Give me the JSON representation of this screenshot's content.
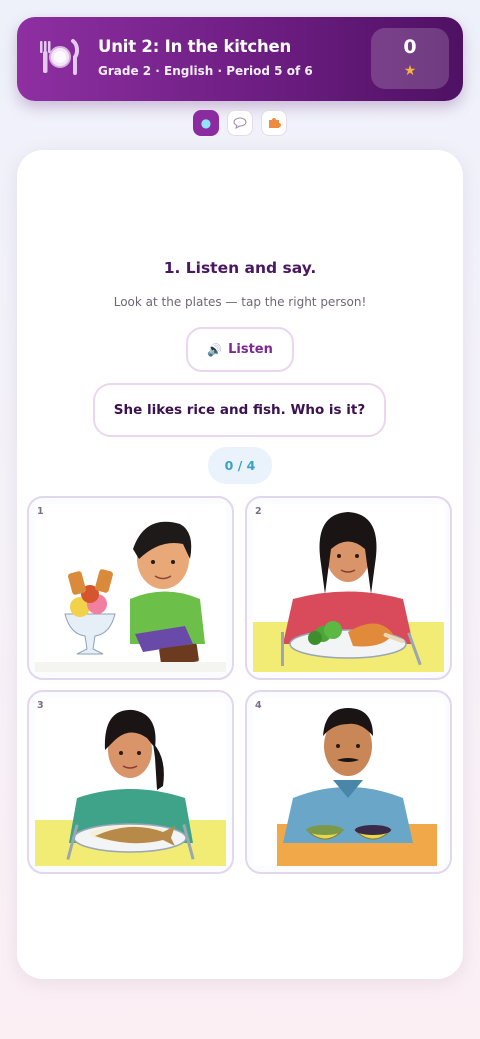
{
  "header": {
    "title": "Unit 2: In the kitchen",
    "subtitle": "Grade 2 · English · Period 5 of 6",
    "score": "0",
    "icon": "plate-icon"
  },
  "mode_tabs": [
    {
      "name": "listen-mode",
      "icon": "dot-icon",
      "active": true
    },
    {
      "name": "speak-mode",
      "icon": "speech-bubble-icon",
      "active": false
    },
    {
      "name": "puzzle-mode",
      "icon": "puzzle-icon",
      "active": false
    }
  ],
  "task": {
    "title": "1. Listen and say.",
    "hint": "Look at the plates — tap the right person!",
    "listen_label": "Listen",
    "question": "She likes rice and fish. Who is it?",
    "progress": "0 / 4"
  },
  "choices": [
    {
      "number": "1",
      "description": "boy with ice cream and chocolate"
    },
    {
      "number": "2",
      "description": "girl with chicken and vegetables"
    },
    {
      "number": "3",
      "description": "girl with rice and fish"
    },
    {
      "number": "4",
      "description": "man with two bowls"
    }
  ],
  "colors": {
    "brand": "#7b2a93",
    "accent_light": "#ead6ef",
    "progress_text": "#3aa0c9",
    "star": "#f3b63c"
  }
}
